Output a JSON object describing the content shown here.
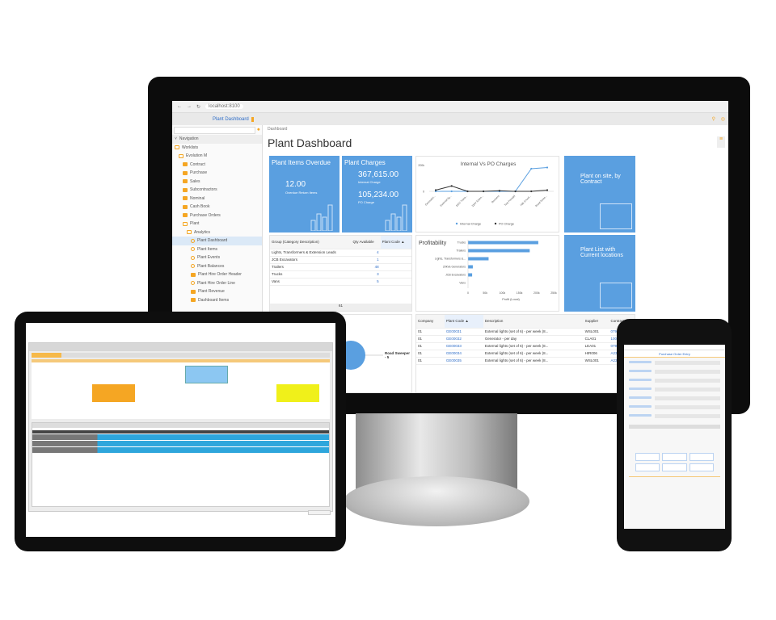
{
  "browser": {
    "url": "localhost:8100",
    "tab": "Plant Dashboard"
  },
  "sidebar": {
    "header": "Navigation",
    "items": [
      {
        "label": "Worklists",
        "icon": "folder-open-icon",
        "level": 0
      },
      {
        "label": "Evolution M",
        "icon": "folder-open-icon",
        "level": 1
      },
      {
        "label": "Contract",
        "icon": "folder-icon",
        "level": 2
      },
      {
        "label": "Purchase",
        "icon": "folder-icon",
        "level": 2
      },
      {
        "label": "Sales",
        "icon": "folder-icon",
        "level": 2
      },
      {
        "label": "Subcontractors",
        "icon": "folder-icon",
        "level": 2
      },
      {
        "label": "Nominal",
        "icon": "folder-icon",
        "level": 2
      },
      {
        "label": "Cash Book",
        "icon": "folder-icon",
        "level": 2
      },
      {
        "label": "Purchase Orders",
        "icon": "folder-icon",
        "level": 2
      },
      {
        "label": "Plant",
        "icon": "folder-open-icon",
        "level": 2
      },
      {
        "label": "Analytics",
        "icon": "folder-open-icon",
        "level": 3
      },
      {
        "label": "Plant Dashboard",
        "icon": "circle-icon",
        "level": 4,
        "selected": true
      },
      {
        "label": "Plant Items",
        "icon": "circle-icon",
        "level": 4
      },
      {
        "label": "Plant Events",
        "icon": "circle-icon",
        "level": 4
      },
      {
        "label": "Plant Balances",
        "icon": "circle-icon",
        "level": 4
      },
      {
        "label": "Plant Hire Order Header",
        "icon": "folder-icon",
        "level": 4
      },
      {
        "label": "Plant Hire Order Line",
        "icon": "circle-icon",
        "level": 4
      },
      {
        "label": "Plant Revenue",
        "icon": "folder-icon",
        "level": 4
      },
      {
        "label": "Dashboard Items",
        "icon": "folder-icon",
        "level": 4
      }
    ]
  },
  "main": {
    "breadcrumb": "Dashboard",
    "title": "Plant Dashboard",
    "tiles": {
      "overdue": {
        "title": "Plant Items Overdue",
        "value": "12.00",
        "caption": "Overdue Return Items"
      },
      "charges": {
        "title": "Plant Charges",
        "value1": "367,615.00",
        "caption1": "Internal Charge",
        "value2": "105,234.00",
        "caption2": "PO Charge"
      },
      "onsite": {
        "title": "Plant on site, by Contract"
      },
      "list": {
        "title": "Plant List with Current locations"
      }
    },
    "group_table": {
      "headers": [
        "Group (Category Description)",
        "Qty Available",
        "Plant Code ▲"
      ],
      "rows": [
        [
          "Lights, Transformers & Extension Leads",
          "4"
        ],
        [
          "JCB Excavators",
          "1"
        ],
        [
          "Trailers",
          "48"
        ],
        [
          "Trucks",
          "3"
        ],
        [
          "Vans",
          "5"
        ]
      ],
      "total": "61"
    },
    "pie": {
      "label": "Road Sweeper - 5"
    },
    "plant_table": {
      "headers": [
        "Company",
        "Plant Code ▲",
        "Description",
        "Supplier",
        "Contract"
      ],
      "rows": [
        [
          "01",
          "GE00031",
          "External lights (set of 6) - per week (8...",
          "WSL001",
          "0797"
        ],
        [
          "01",
          "GE00032",
          "Generator - per day",
          "CLA01",
          "1000"
        ],
        [
          "01",
          "GE00033",
          "External lights (set of 6) - per week (8...",
          "LEA01",
          "0797"
        ],
        [
          "01",
          "GE00034",
          "External lights (set of 6) - per week (8...",
          "HIR006",
          "A233"
        ],
        [
          "01",
          "GE00035",
          "External lights (set of 6) - per week (8...",
          "WSL001",
          "A233"
        ]
      ]
    }
  },
  "chart_data": [
    {
      "type": "line",
      "title": "Internal Vs PO Charges",
      "categories": [
        "Generator...",
        "External lig...",
        "110V Trans...",
        "110V Exten...",
        "Bowsers",
        "Test Pmodel",
        "Hilti 3 Axel...",
        "Road Swee..."
      ],
      "yticks": [
        "0",
        "200k"
      ],
      "ylim": [
        0,
        210000
      ],
      "series": [
        {
          "name": "Internal Charge",
          "color": "#5a9fe0",
          "values": [
            0,
            0,
            0,
            0,
            0,
            0,
            190000,
            200000
          ]
        },
        {
          "name": "PO Charge",
          "color": "#333333",
          "values": [
            10000,
            45000,
            0,
            0,
            5000,
            0,
            0,
            10000
          ]
        }
      ],
      "legend": "bottom"
    },
    {
      "type": "bar",
      "orientation": "horizontal",
      "title": "Profitability",
      "categories": [
        "Trucks",
        "Trailers",
        "Lights, Transformers &...",
        "20kVa Generators",
        "JCB Excavators",
        "Vans"
      ],
      "values": [
        205000,
        180000,
        60000,
        14000,
        12000,
        0
      ],
      "xticks": [
        "0",
        "50k",
        "100k",
        "150k",
        "200k",
        "250k"
      ],
      "xlim": [
        0,
        250000
      ],
      "xlabel": "Profit (Local)",
      "color": "#5a9fe0"
    }
  ],
  "phone": {
    "title": "Purchase Order Entry"
  }
}
